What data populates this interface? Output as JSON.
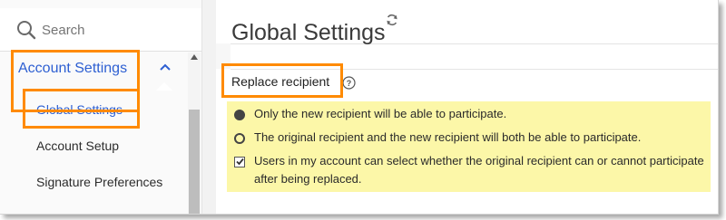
{
  "search": {
    "placeholder": "Search",
    "icon": "search-icon"
  },
  "sidebar": {
    "group": {
      "label": "Account Settings",
      "expanded": true,
      "icon": "chevron-up-icon"
    },
    "items": [
      {
        "label": "Global Settings",
        "active": true
      },
      {
        "label": "Account Setup",
        "active": false
      },
      {
        "label": "Signature Preferences",
        "active": false
      }
    ]
  },
  "main": {
    "title": "Global Settings",
    "refresh_icon": "refresh-icon",
    "section": {
      "label": "Replace recipient",
      "help_icon": "help-icon",
      "options": [
        {
          "type": "radio",
          "selected": true,
          "text": "Only the new recipient will be able to participate."
        },
        {
          "type": "radio",
          "selected": false,
          "text": "The original recipient and the new recipient will both be able to participate."
        },
        {
          "type": "checkbox",
          "checked": true,
          "text": "Users in my account can select whether the original recipient can or cannot participate after being replaced."
        }
      ]
    }
  },
  "colors": {
    "link_blue": "#2d5fd2",
    "highlight_box": "#ff8a00",
    "options_background": "#fcf7a8"
  }
}
